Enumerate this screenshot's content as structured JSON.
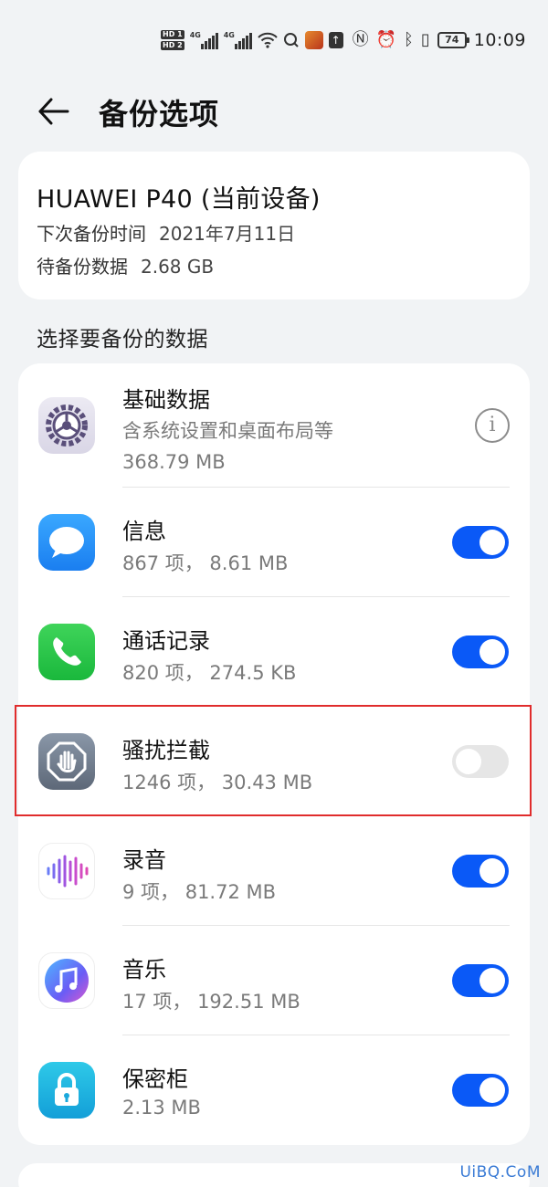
{
  "status_bar": {
    "hd1": "HD 1",
    "hd2": "HD 2",
    "net1": "4G",
    "net2": "4G",
    "battery": "74",
    "time": "10:09",
    "icons": [
      "hd-icon",
      "signal-icon",
      "signal-icon",
      "wifi-icon",
      "hotspot-icon",
      "game-app-icon",
      "upload-icon",
      "nfc-icon",
      "alarm-icon",
      "bluetooth-icon",
      "vibrate-icon",
      "battery-icon"
    ]
  },
  "header": {
    "title": "备份选项",
    "back_icon": "arrow-left-icon"
  },
  "device": {
    "name": "HUAWEI P40 (当前设备)",
    "next_backup_label": "下次备份时间",
    "next_backup_value": "2021年7月11日",
    "pending_label": "待备份数据",
    "pending_value": "2.68 GB"
  },
  "section_title": "选择要备份的数据",
  "items": [
    {
      "title": "基础数据",
      "desc": "含系统设置和桌面布局等",
      "size": "368.79 MB",
      "icon": "settings-gear-icon",
      "control": "info"
    },
    {
      "title": "信息",
      "desc": "867 项， 8.61 MB",
      "icon": "messages-icon",
      "control": "toggle",
      "on": true
    },
    {
      "title": "通话记录",
      "desc": "820 项， 274.5 KB",
      "icon": "phone-icon",
      "control": "toggle",
      "on": true
    },
    {
      "title": "骚扰拦截",
      "desc": "1246 项， 30.43 MB",
      "icon": "hand-block-icon",
      "control": "toggle",
      "on": false
    },
    {
      "title": "录音",
      "desc": "9 项， 81.72 MB",
      "icon": "recorder-waveform-icon",
      "control": "toggle",
      "on": true
    },
    {
      "title": "音乐",
      "desc": "17 项， 192.51 MB",
      "icon": "music-note-icon",
      "control": "toggle",
      "on": true
    },
    {
      "title": "保密柜",
      "desc": "2.13 MB",
      "icon": "lock-icon",
      "control": "toggle",
      "on": true
    }
  ],
  "colors": {
    "accent": "#0a59f7",
    "background": "#f1f3f5",
    "highlight": "#e02c2c"
  },
  "watermark": "UiBQ.CoM"
}
